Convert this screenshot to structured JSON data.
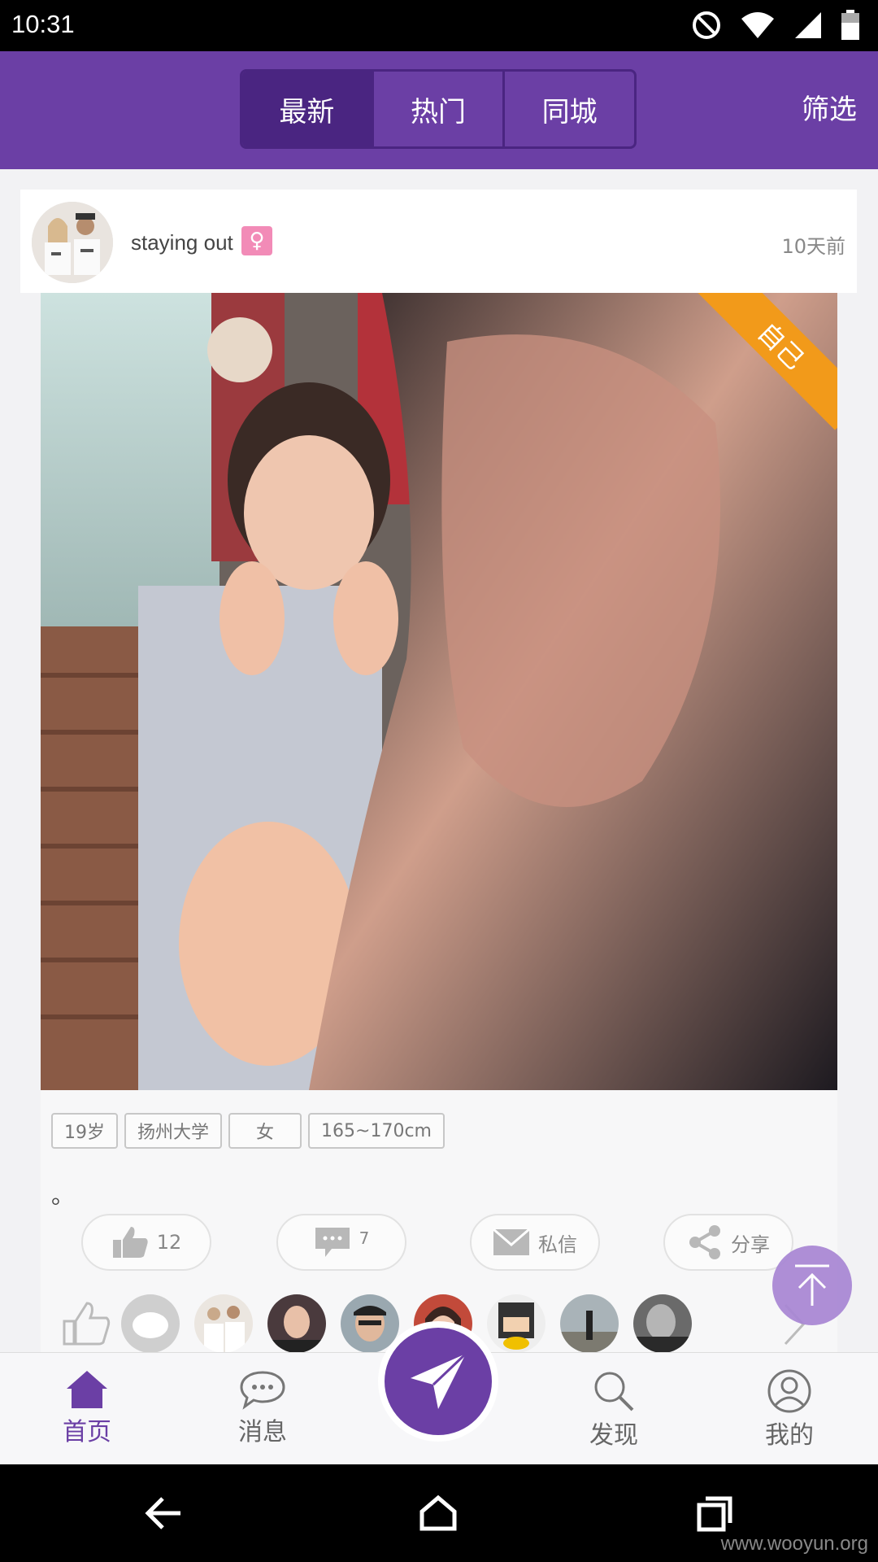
{
  "status_bar": {
    "time": "10:31"
  },
  "header": {
    "tabs": [
      {
        "label": "最新"
      },
      {
        "label": "热门"
      },
      {
        "label": "同城"
      }
    ],
    "filter_label": "筛选"
  },
  "post": {
    "username": "staying out",
    "gender_symbol": "♀",
    "time_ago": "10天前",
    "ribbon_label": "自己",
    "tags": [
      "19岁",
      "扬州大学",
      "女",
      "165~170cm"
    ],
    "content": "。",
    "like_count": "12",
    "comment_count": "7",
    "message_label": "私信",
    "share_label": "分享"
  },
  "bottom_nav": {
    "items": [
      {
        "label": "首页"
      },
      {
        "label": "消息"
      },
      {
        "label": "发现"
      },
      {
        "label": "我的"
      }
    ]
  },
  "watermark": "www.wooyun.org",
  "colors": {
    "primary": "#6b3fa5",
    "primary_dark": "#4a2581",
    "ribbon": "#f29a1a",
    "gender": "#f28bb7"
  }
}
